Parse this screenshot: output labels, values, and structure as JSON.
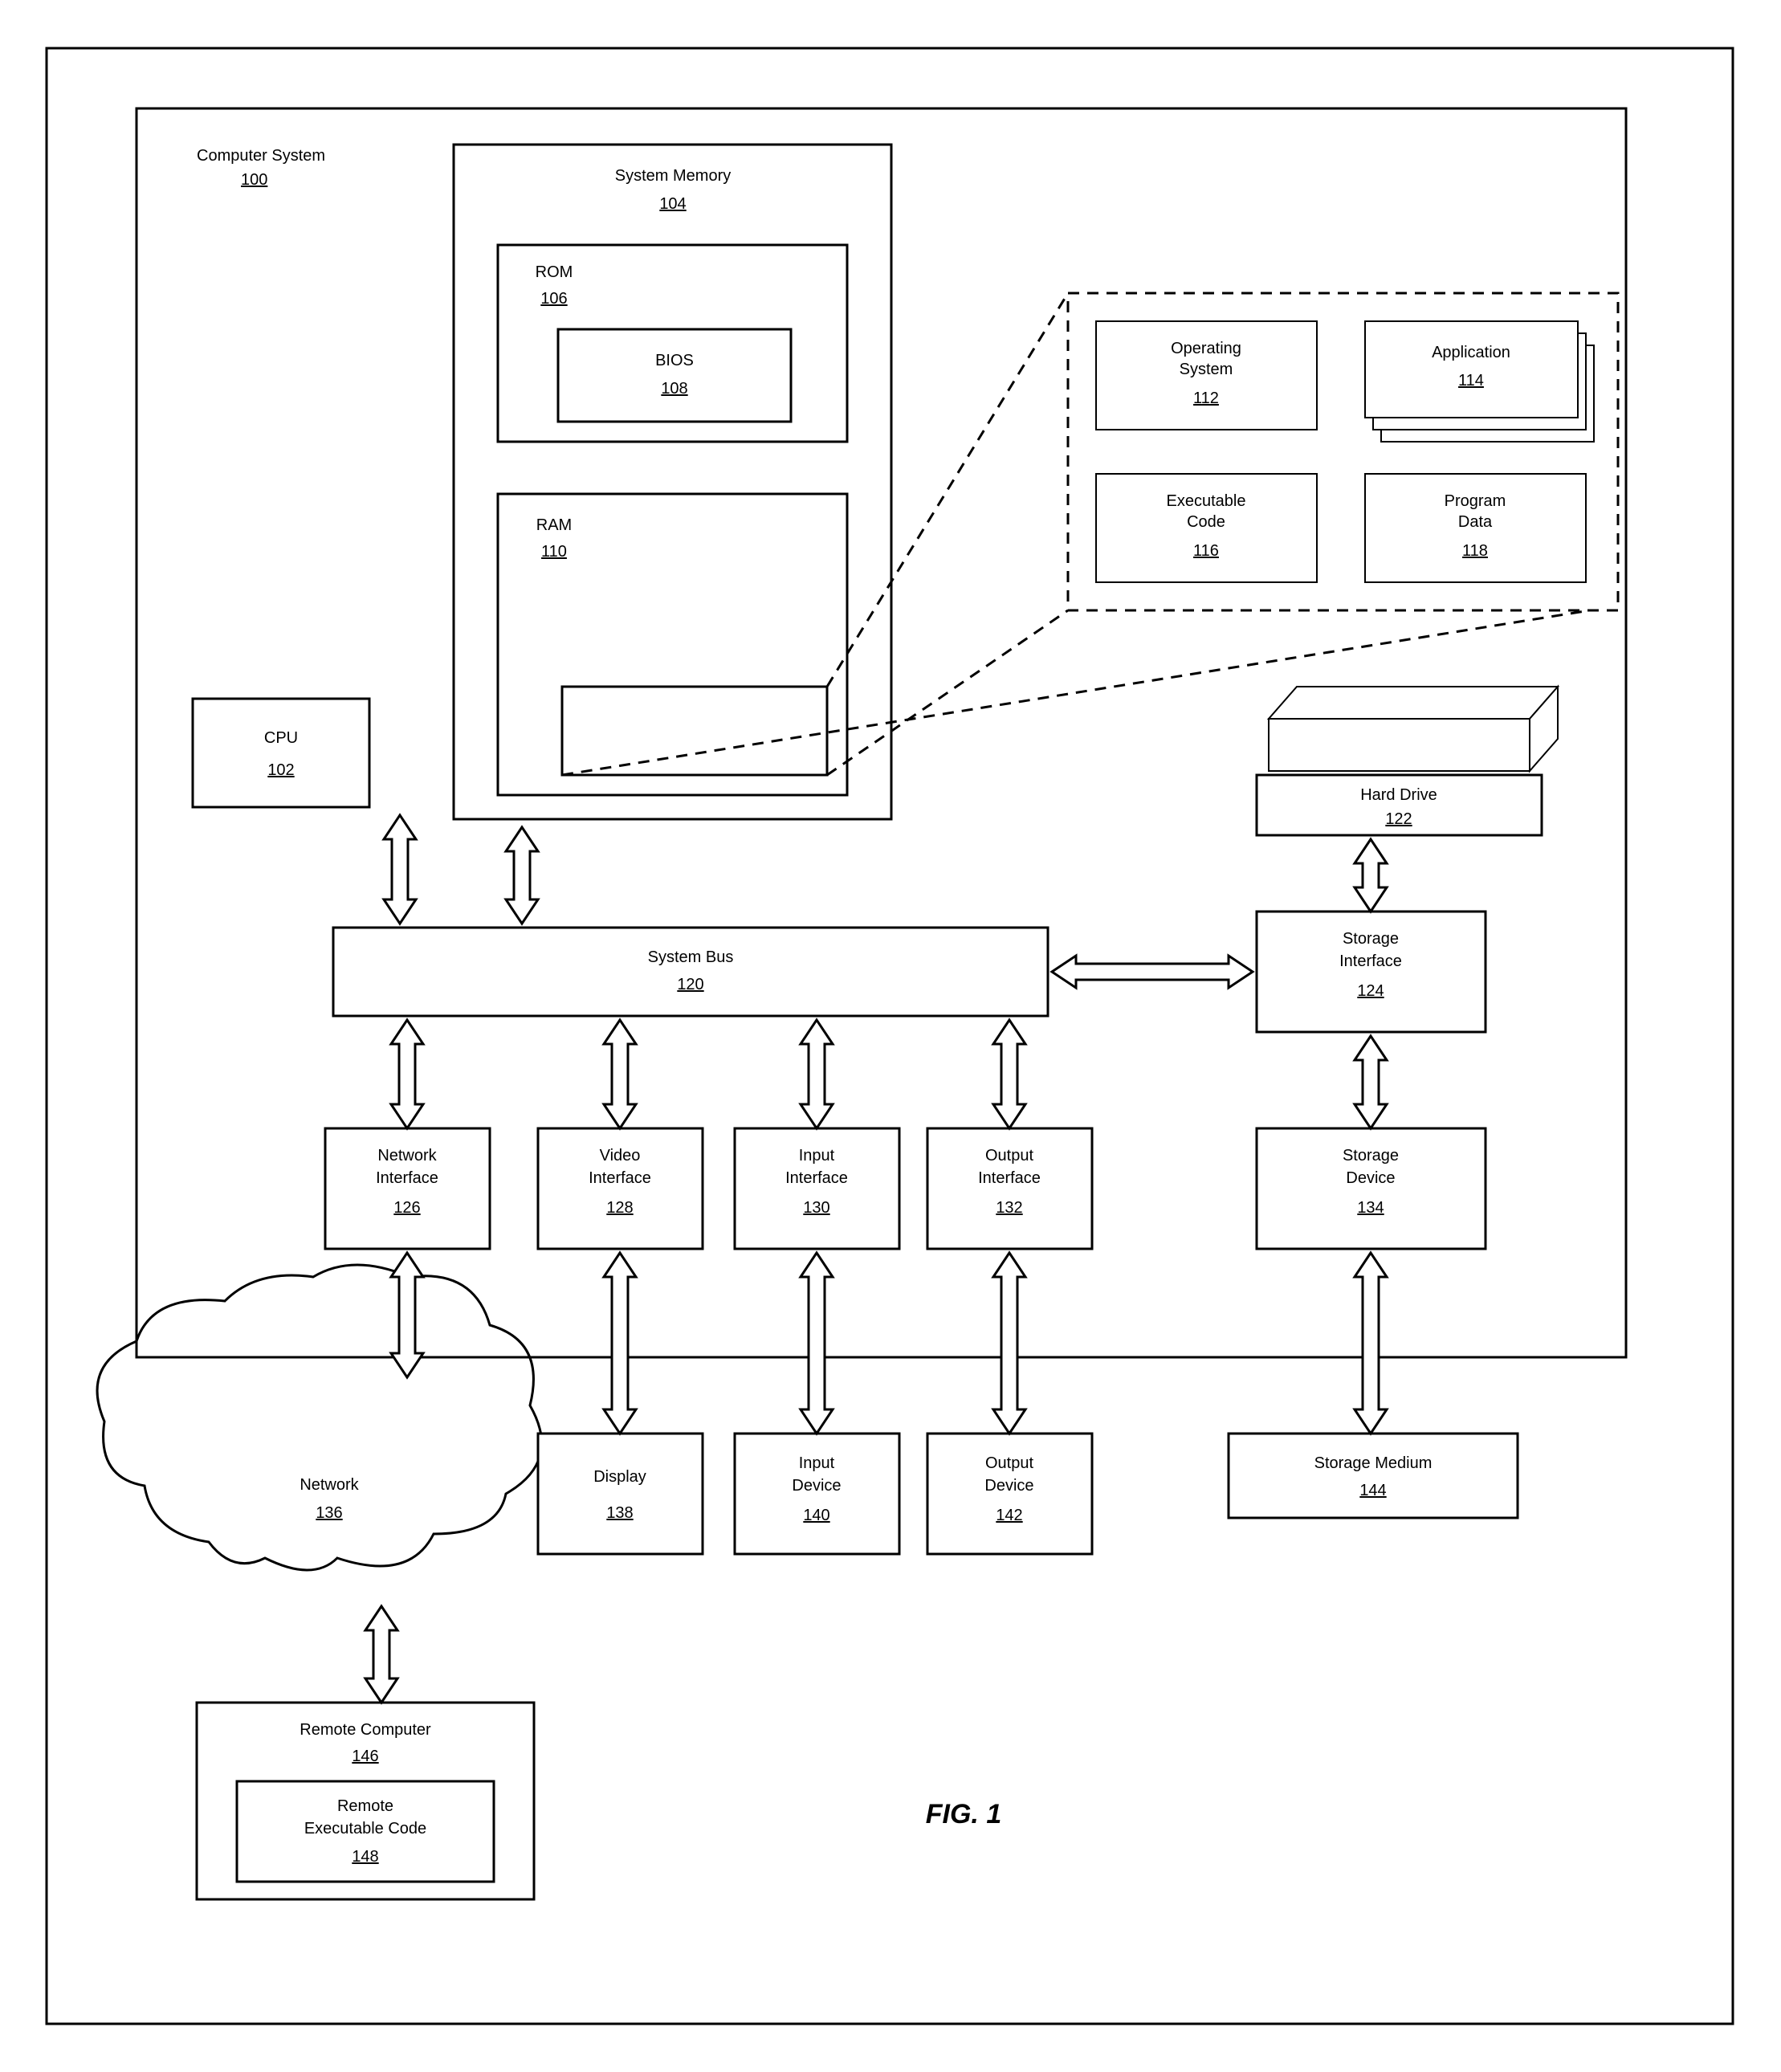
{
  "figure": "FIG. 1",
  "computer_system": {
    "label": "Computer System",
    "ref": "100"
  },
  "cpu": {
    "label": "CPU",
    "ref": "102"
  },
  "system_memory": {
    "label": "System Memory",
    "ref": "104"
  },
  "rom": {
    "label": "ROM",
    "ref": "106"
  },
  "bios": {
    "label": "BIOS",
    "ref": "108"
  },
  "ram": {
    "label": "RAM",
    "ref": "110"
  },
  "operating_system": {
    "label": "Operating System",
    "ref": "112"
  },
  "application": {
    "label": "Application",
    "ref": "114"
  },
  "executable_code": {
    "label": "Executable Code",
    "ref": "116"
  },
  "program_data": {
    "label": "Program Data",
    "ref": "118"
  },
  "system_bus": {
    "label": "System Bus",
    "ref": "120"
  },
  "hard_drive": {
    "label": "Hard Drive",
    "ref": "122"
  },
  "storage_interface": {
    "label": "Storage Interface",
    "ref": "124"
  },
  "network_interface": {
    "label": "Network Interface",
    "ref": "126"
  },
  "video_interface": {
    "label": "Video Interface",
    "ref": "128"
  },
  "input_interface": {
    "label": "Input Interface",
    "ref": "130"
  },
  "output_interface": {
    "label": "Output Interface",
    "ref": "132"
  },
  "storage_device": {
    "label": "Storage Device",
    "ref": "134"
  },
  "network": {
    "label": "Network",
    "ref": "136"
  },
  "display": {
    "label": "Display",
    "ref": "138"
  },
  "input_device": {
    "label": "Input Device",
    "ref": "140"
  },
  "output_device": {
    "label": "Output Device",
    "ref": "142"
  },
  "storage_medium": {
    "label": "Storage Medium",
    "ref": "144"
  },
  "remote_computer": {
    "label": "Remote Computer",
    "ref": "146"
  },
  "remote_executable_code": {
    "label": "Remote Executable Code",
    "ref": "148"
  }
}
